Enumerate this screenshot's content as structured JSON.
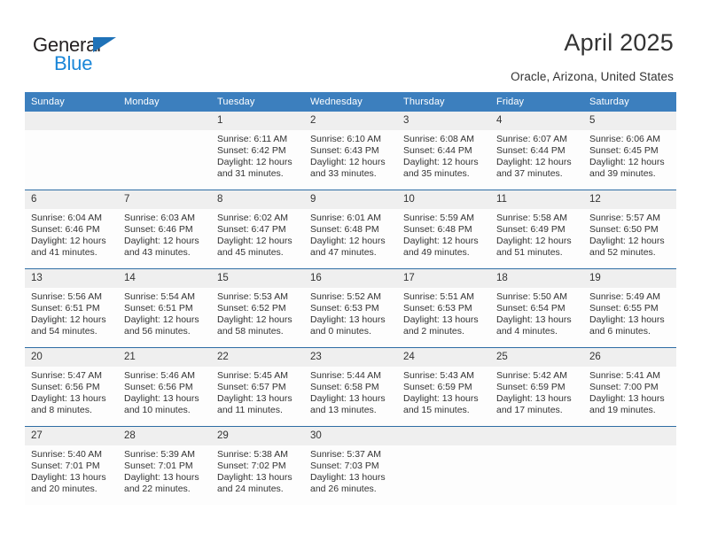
{
  "brand": {
    "name_top": "General",
    "name_bottom": "Blue",
    "triangle_color": "#1f72b8",
    "text_color_top": "#231f20",
    "text_color_bottom": "#1a86d8"
  },
  "header": {
    "title": "April 2025",
    "location": "Oracle, Arizona, United States"
  },
  "colors": {
    "header_bar": "#3c7fbe",
    "row_divider": "#2e6da4",
    "daynum_band": "#efefef",
    "cell_background": "#fdfdfd",
    "text": "#333333"
  },
  "calendar": {
    "weekday_headers": [
      "Sunday",
      "Monday",
      "Tuesday",
      "Wednesday",
      "Thursday",
      "Friday",
      "Saturday"
    ],
    "weeks": [
      [
        {
          "day": "",
          "lines": []
        },
        {
          "day": "",
          "lines": []
        },
        {
          "day": "1",
          "lines": [
            "Sunrise: 6:11 AM",
            "Sunset: 6:42 PM",
            "Daylight: 12 hours",
            "and 31 minutes."
          ]
        },
        {
          "day": "2",
          "lines": [
            "Sunrise: 6:10 AM",
            "Sunset: 6:43 PM",
            "Daylight: 12 hours",
            "and 33 minutes."
          ]
        },
        {
          "day": "3",
          "lines": [
            "Sunrise: 6:08 AM",
            "Sunset: 6:44 PM",
            "Daylight: 12 hours",
            "and 35 minutes."
          ]
        },
        {
          "day": "4",
          "lines": [
            "Sunrise: 6:07 AM",
            "Sunset: 6:44 PM",
            "Daylight: 12 hours",
            "and 37 minutes."
          ]
        },
        {
          "day": "5",
          "lines": [
            "Sunrise: 6:06 AM",
            "Sunset: 6:45 PM",
            "Daylight: 12 hours",
            "and 39 minutes."
          ]
        }
      ],
      [
        {
          "day": "6",
          "lines": [
            "Sunrise: 6:04 AM",
            "Sunset: 6:46 PM",
            "Daylight: 12 hours",
            "and 41 minutes."
          ]
        },
        {
          "day": "7",
          "lines": [
            "Sunrise: 6:03 AM",
            "Sunset: 6:46 PM",
            "Daylight: 12 hours",
            "and 43 minutes."
          ]
        },
        {
          "day": "8",
          "lines": [
            "Sunrise: 6:02 AM",
            "Sunset: 6:47 PM",
            "Daylight: 12 hours",
            "and 45 minutes."
          ]
        },
        {
          "day": "9",
          "lines": [
            "Sunrise: 6:01 AM",
            "Sunset: 6:48 PM",
            "Daylight: 12 hours",
            "and 47 minutes."
          ]
        },
        {
          "day": "10",
          "lines": [
            "Sunrise: 5:59 AM",
            "Sunset: 6:48 PM",
            "Daylight: 12 hours",
            "and 49 minutes."
          ]
        },
        {
          "day": "11",
          "lines": [
            "Sunrise: 5:58 AM",
            "Sunset: 6:49 PM",
            "Daylight: 12 hours",
            "and 51 minutes."
          ]
        },
        {
          "day": "12",
          "lines": [
            "Sunrise: 5:57 AM",
            "Sunset: 6:50 PM",
            "Daylight: 12 hours",
            "and 52 minutes."
          ]
        }
      ],
      [
        {
          "day": "13",
          "lines": [
            "Sunrise: 5:56 AM",
            "Sunset: 6:51 PM",
            "Daylight: 12 hours",
            "and 54 minutes."
          ]
        },
        {
          "day": "14",
          "lines": [
            "Sunrise: 5:54 AM",
            "Sunset: 6:51 PM",
            "Daylight: 12 hours",
            "and 56 minutes."
          ]
        },
        {
          "day": "15",
          "lines": [
            "Sunrise: 5:53 AM",
            "Sunset: 6:52 PM",
            "Daylight: 12 hours",
            "and 58 minutes."
          ]
        },
        {
          "day": "16",
          "lines": [
            "Sunrise: 5:52 AM",
            "Sunset: 6:53 PM",
            "Daylight: 13 hours",
            "and 0 minutes."
          ]
        },
        {
          "day": "17",
          "lines": [
            "Sunrise: 5:51 AM",
            "Sunset: 6:53 PM",
            "Daylight: 13 hours",
            "and 2 minutes."
          ]
        },
        {
          "day": "18",
          "lines": [
            "Sunrise: 5:50 AM",
            "Sunset: 6:54 PM",
            "Daylight: 13 hours",
            "and 4 minutes."
          ]
        },
        {
          "day": "19",
          "lines": [
            "Sunrise: 5:49 AM",
            "Sunset: 6:55 PM",
            "Daylight: 13 hours",
            "and 6 minutes."
          ]
        }
      ],
      [
        {
          "day": "20",
          "lines": [
            "Sunrise: 5:47 AM",
            "Sunset: 6:56 PM",
            "Daylight: 13 hours",
            "and 8 minutes."
          ]
        },
        {
          "day": "21",
          "lines": [
            "Sunrise: 5:46 AM",
            "Sunset: 6:56 PM",
            "Daylight: 13 hours",
            "and 10 minutes."
          ]
        },
        {
          "day": "22",
          "lines": [
            "Sunrise: 5:45 AM",
            "Sunset: 6:57 PM",
            "Daylight: 13 hours",
            "and 11 minutes."
          ]
        },
        {
          "day": "23",
          "lines": [
            "Sunrise: 5:44 AM",
            "Sunset: 6:58 PM",
            "Daylight: 13 hours",
            "and 13 minutes."
          ]
        },
        {
          "day": "24",
          "lines": [
            "Sunrise: 5:43 AM",
            "Sunset: 6:59 PM",
            "Daylight: 13 hours",
            "and 15 minutes."
          ]
        },
        {
          "day": "25",
          "lines": [
            "Sunrise: 5:42 AM",
            "Sunset: 6:59 PM",
            "Daylight: 13 hours",
            "and 17 minutes."
          ]
        },
        {
          "day": "26",
          "lines": [
            "Sunrise: 5:41 AM",
            "Sunset: 7:00 PM",
            "Daylight: 13 hours",
            "and 19 minutes."
          ]
        }
      ],
      [
        {
          "day": "27",
          "lines": [
            "Sunrise: 5:40 AM",
            "Sunset: 7:01 PM",
            "Daylight: 13 hours",
            "and 20 minutes."
          ]
        },
        {
          "day": "28",
          "lines": [
            "Sunrise: 5:39 AM",
            "Sunset: 7:01 PM",
            "Daylight: 13 hours",
            "and 22 minutes."
          ]
        },
        {
          "day": "29",
          "lines": [
            "Sunrise: 5:38 AM",
            "Sunset: 7:02 PM",
            "Daylight: 13 hours",
            "and 24 minutes."
          ]
        },
        {
          "day": "30",
          "lines": [
            "Sunrise: 5:37 AM",
            "Sunset: 7:03 PM",
            "Daylight: 13 hours",
            "and 26 minutes."
          ]
        },
        {
          "day": "",
          "lines": []
        },
        {
          "day": "",
          "lines": []
        },
        {
          "day": "",
          "lines": []
        }
      ]
    ]
  }
}
